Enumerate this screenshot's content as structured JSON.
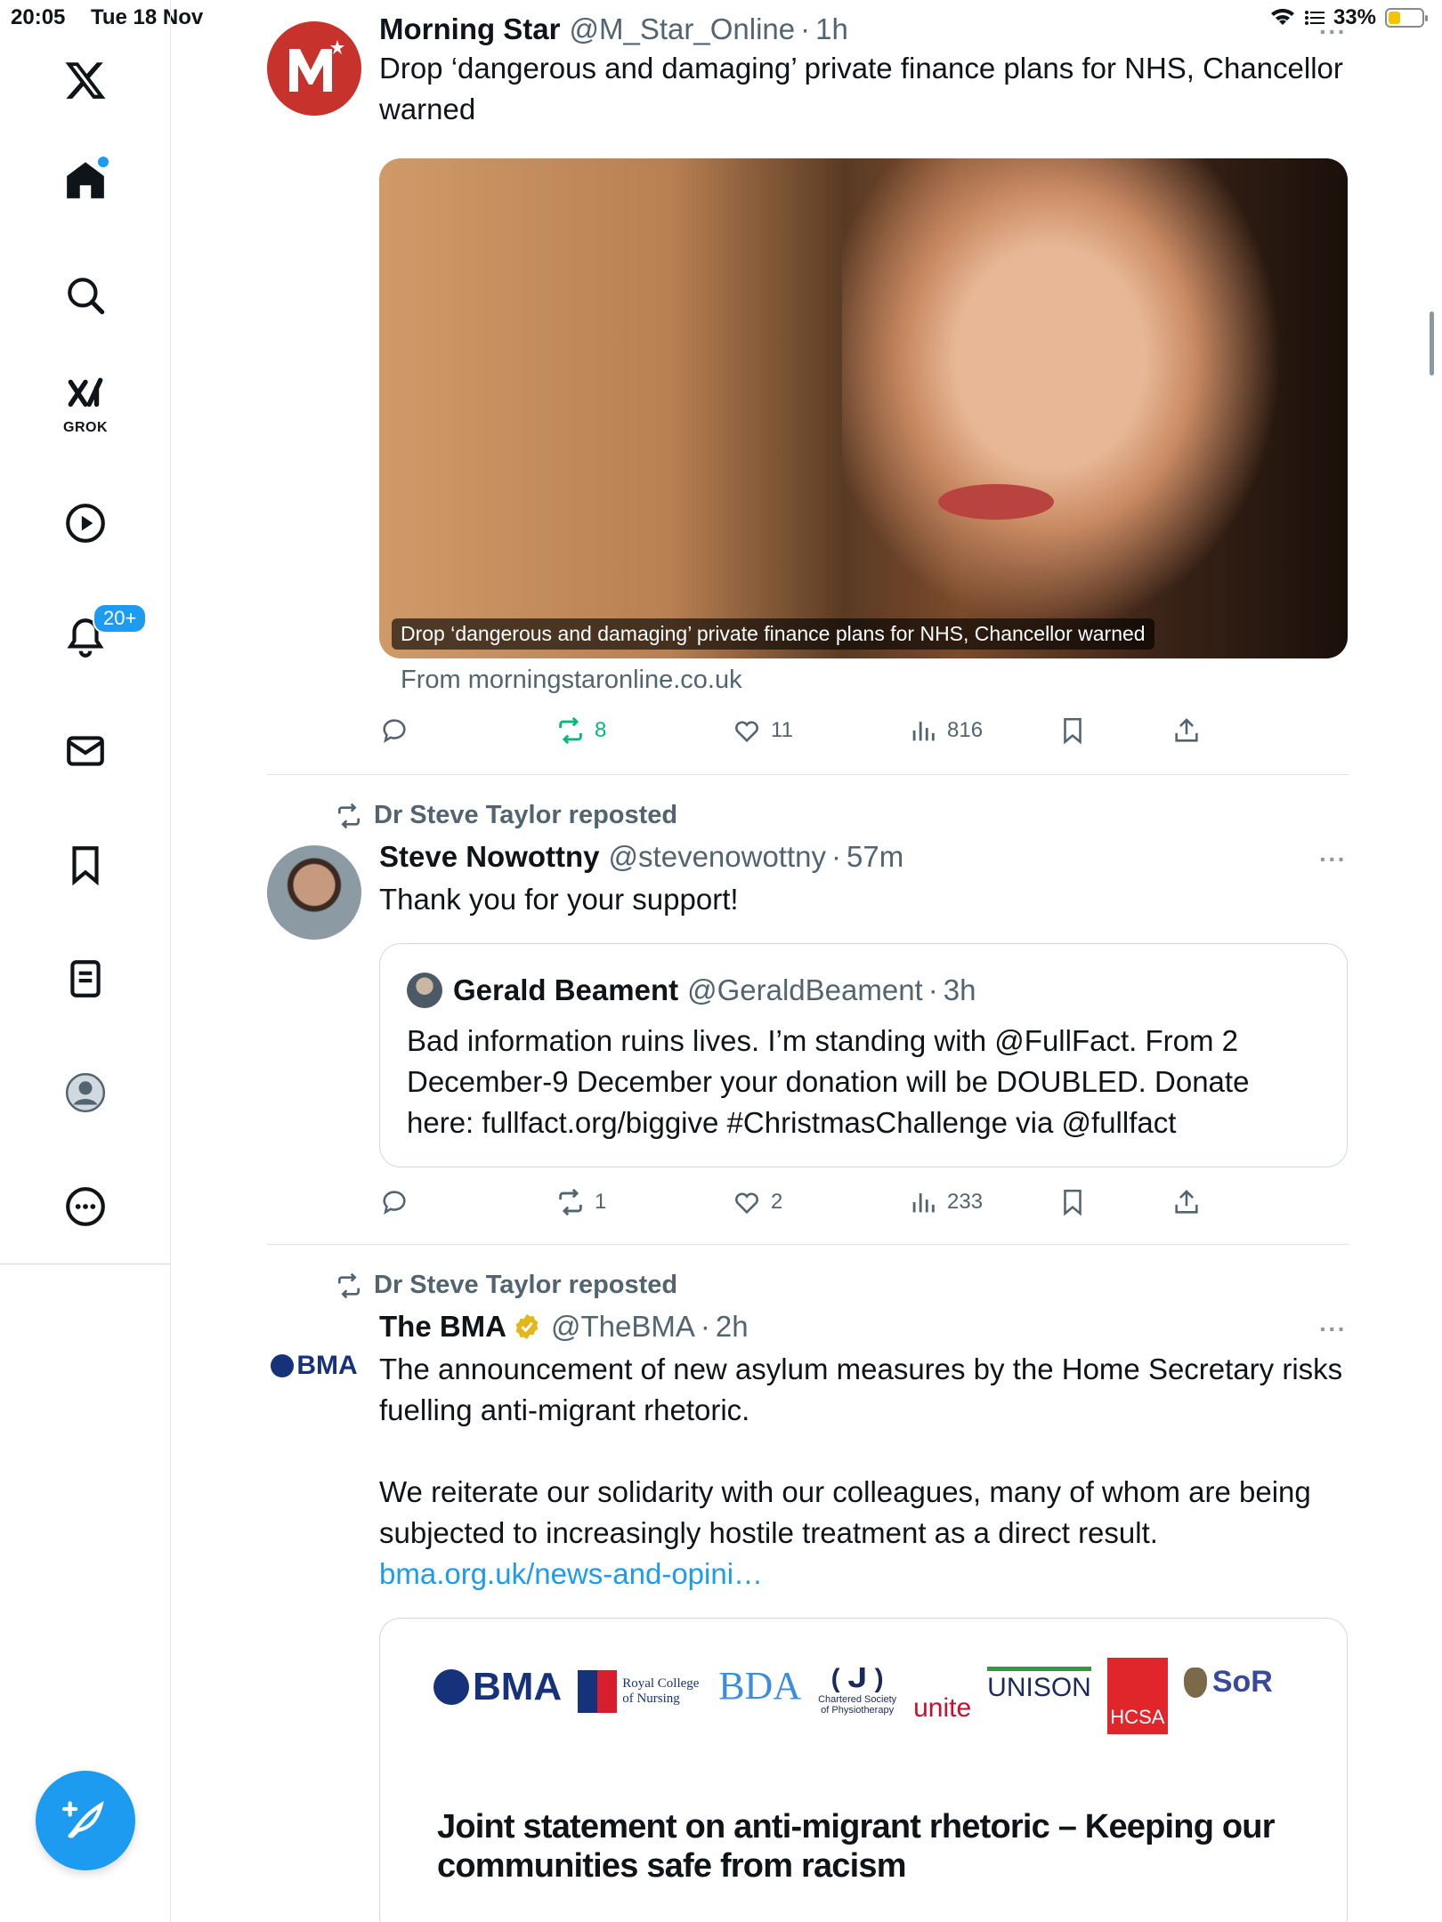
{
  "status_bar": {
    "time": "20:05",
    "date": "Tue 18 Nov",
    "battery": "33%",
    "battery_level": 0.33
  },
  "sidebar": {
    "items": [
      {
        "name": "x-logo-icon"
      },
      {
        "name": "home-icon",
        "dot": true
      },
      {
        "name": "search-icon"
      },
      {
        "name": "grok-icon",
        "label": "GROK"
      },
      {
        "name": "video-icon"
      },
      {
        "name": "notifications-icon",
        "badge": "20+"
      },
      {
        "name": "messages-icon"
      },
      {
        "name": "bookmarks-icon"
      },
      {
        "name": "lists-icon"
      },
      {
        "name": "profile-icon"
      },
      {
        "name": "more-icon"
      }
    ],
    "compose": "compose-post-icon"
  },
  "tweets": [
    {
      "name": "Morning Star",
      "handle": "@M_Star_Online",
      "time": "1h",
      "text": "Drop ‘dangerous and damaging’ private finance plans for NHS, Chancellor warned",
      "card": {
        "caption": "Drop ‘dangerous and damaging’ private finance plans for NHS, Chancellor warned",
        "from": "From morningstaronline.co.uk"
      },
      "stats": {
        "replies": "",
        "reposts": "8",
        "likes": "11",
        "views": "816"
      }
    },
    {
      "repost_label": "Dr Steve Taylor reposted",
      "name": "Steve Nowottny",
      "handle": "@stevenowottny",
      "time": "57m",
      "text": "Thank you for your support!",
      "quote": {
        "name": "Gerald Beament",
        "handle": "@GeraldBeament",
        "time": "3h",
        "text": "Bad information ruins lives. I’m standing with @FullFact. From 2 December-9 December your donation will be DOUBLED. Donate here: fullfact.org/biggive #ChristmasChallenge via @fullfact"
      },
      "stats": {
        "replies": "",
        "reposts": "1",
        "likes": "2",
        "views": "233"
      }
    },
    {
      "repost_label": "Dr Steve Taylor reposted",
      "name": "The BMA",
      "handle": "@TheBMA",
      "time": "2h",
      "avatar_text": "BMA",
      "text_1": "The announcement of new asylum measures by the Home Secretary risks fuelling anti-migrant rhetoric.",
      "text_2": "We reiterate our solidarity with our colleagues, many of whom are being subjected to increasingly hostile treatment as a direct result.",
      "link": "bma.org.uk/news-and-opini…",
      "card": {
        "logos": [
          "BMA",
          "Royal College of Nursing",
          "BDA",
          "Chartered Society of Physiotherapy",
          "unite",
          "UNISON",
          "HCSA",
          "SoR"
        ],
        "title": "Joint statement on anti-migrant rhetoric – Keeping our communities safe from racism"
      }
    }
  ],
  "colors": {
    "accent": "#1d9bf0",
    "repost_green": "#00ba7c",
    "secondary_text": "#536471"
  }
}
